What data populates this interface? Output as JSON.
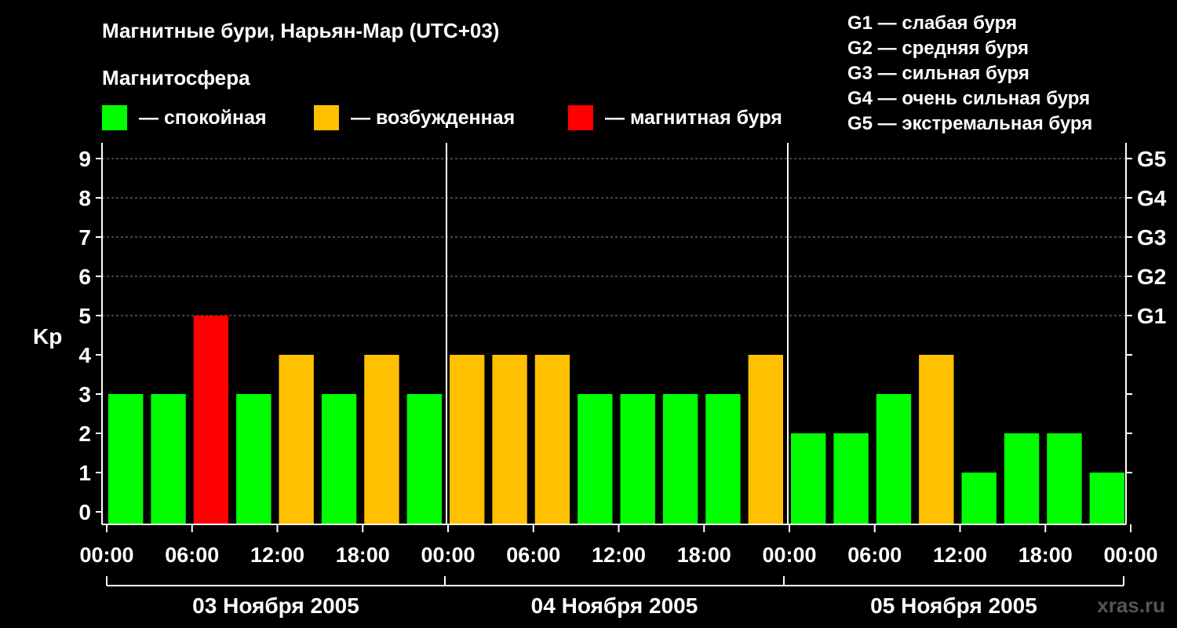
{
  "chart_data": {
    "type": "bar",
    "title": "Магнитные бури, Нарьян-Мар (UTC+03)",
    "subtitle": "Магнитосфера",
    "ylabel": "Kp",
    "ylim": [
      0,
      9
    ],
    "y_ticks": [
      "0",
      "1",
      "2",
      "3",
      "4",
      "5",
      "6",
      "7",
      "8",
      "9"
    ],
    "right_ticks": [
      {
        "kp": 5,
        "label": "G1"
      },
      {
        "kp": 6,
        "label": "G2"
      },
      {
        "kp": 7,
        "label": "G3"
      },
      {
        "kp": 8,
        "label": "G4"
      },
      {
        "kp": 9,
        "label": "G5"
      }
    ],
    "legend": [
      {
        "label": "— спокойная",
        "color": "#00ff00"
      },
      {
        "label": "— возбужденная",
        "color": "#ffc000"
      },
      {
        "label": "— магнитная буря",
        "color": "#ff0000"
      }
    ],
    "storm_scale": [
      "G1 — слабая буря",
      "G2 — средняя буря",
      "G3 — сильная буря",
      "G4 — очень сильная буря",
      "G5 — экстремальная буря"
    ],
    "x_ticks": [
      "00:00",
      "06:00",
      "12:00",
      "18:00",
      "00:00",
      "06:00",
      "12:00",
      "18:00",
      "00:00",
      "06:00",
      "12:00",
      "18:00",
      "00:00"
    ],
    "days": [
      "03 Ноября 2005",
      "04 Ноября 2005",
      "05 Ноября 2005"
    ],
    "interval_hours": 3,
    "series": [
      {
        "values": [
          3,
          3,
          5,
          3,
          4,
          3,
          4,
          3,
          4,
          4,
          4,
          3,
          3,
          3,
          3,
          4,
          2,
          2,
          3,
          4,
          1,
          2,
          2,
          1
        ]
      }
    ],
    "grid": "dashed at Kp 5-9",
    "colors": {
      "quiet": "#00ff00",
      "active": "#ffc000",
      "storm": "#ff0000"
    }
  },
  "watermark": "xras.ru"
}
